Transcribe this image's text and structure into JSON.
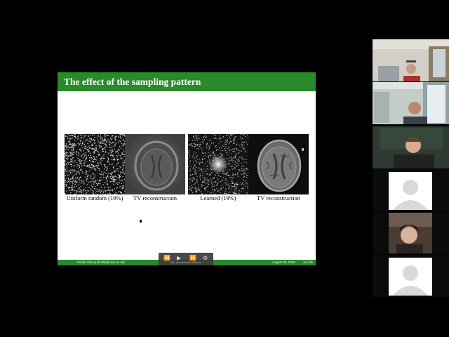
{
  "slide": {
    "title": "The effect of the sampling pattern",
    "captions": {
      "uniform": "Uniform random (19%)",
      "tv1": "TV reconstruction",
      "learned": "Learned (19%)",
      "tv2": "TV reconstruction"
    },
    "footer": {
      "author": "Ferdia Sherry (fs436@cam.ac.uk)",
      "topic": "Min. of nonconvex problems",
      "date": "August 25, 2020",
      "page": "13 / 38"
    }
  },
  "player": {
    "rewind_icon": "rewind-icon",
    "play_icon": "play-icon",
    "forward_icon": "fast-forward-icon",
    "settings_icon": "gear-icon"
  },
  "colors": {
    "header_green": "#2a8a2a",
    "background": "#000000",
    "slide_bg": "#ffffff",
    "placeholder_avatar": "#d9d9d9"
  }
}
